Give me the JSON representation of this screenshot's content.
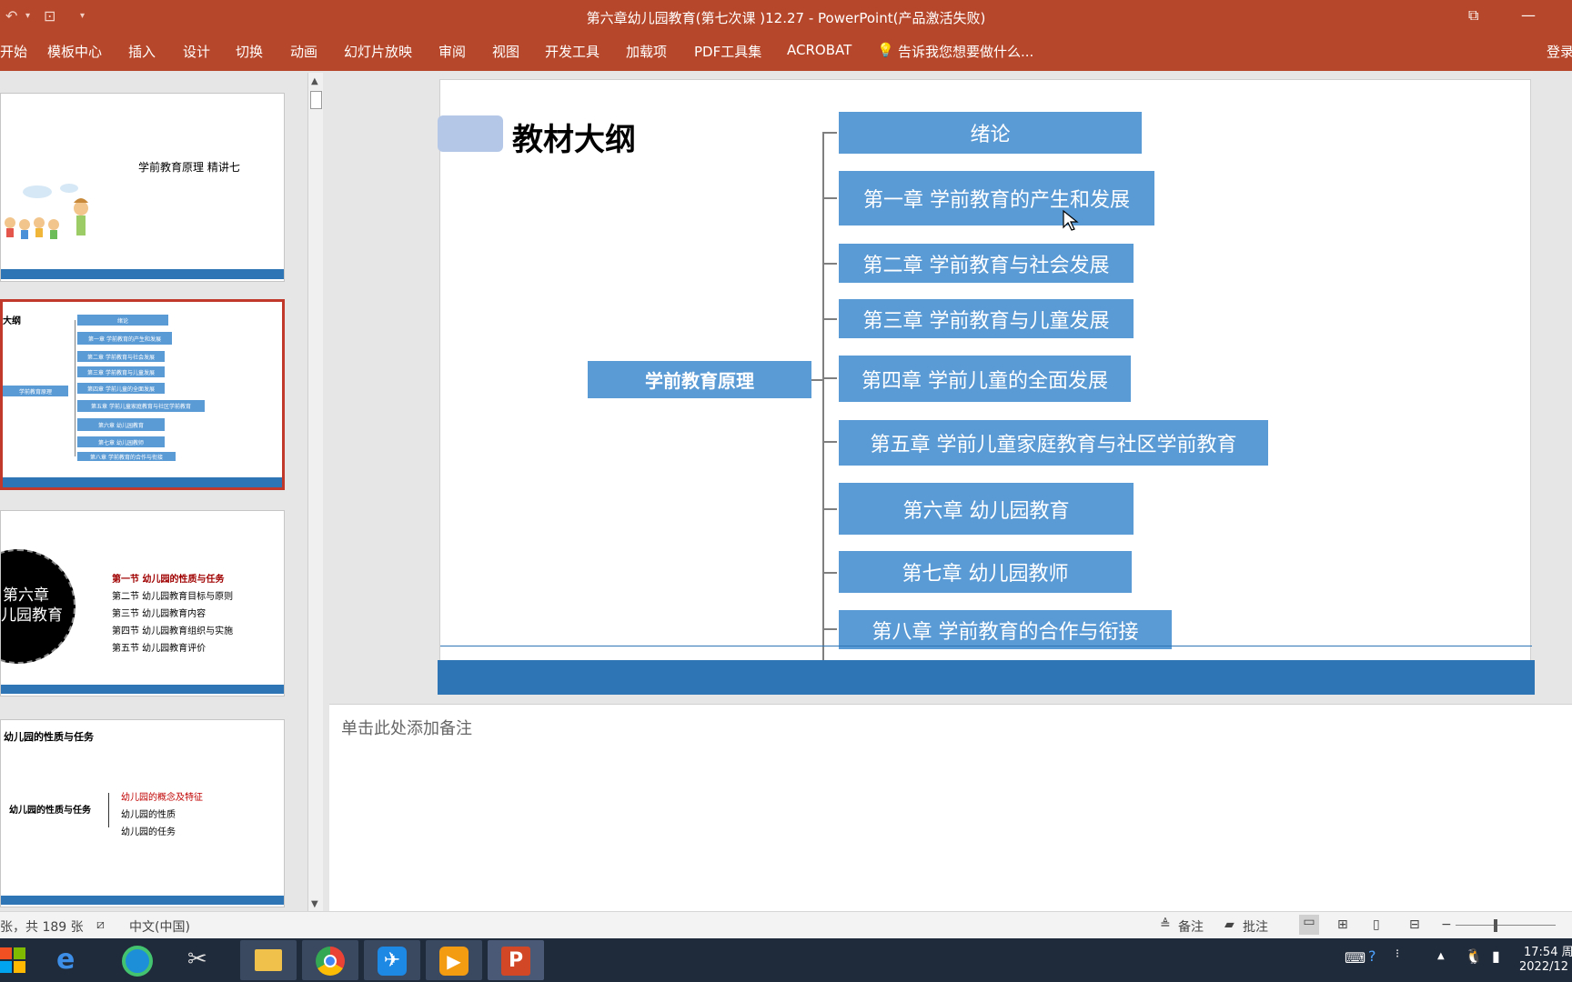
{
  "window": {
    "title": "第六章幼儿园教育(第七次课 )12.27 - PowerPoint(产品激活失败)"
  },
  "ribbon": {
    "tabs": [
      "开始",
      "模板中心",
      "插入",
      "设计",
      "切换",
      "动画",
      "幻灯片放映",
      "审阅",
      "视图",
      "开发工具",
      "加载项",
      "PDF工具集",
      "ACROBAT"
    ],
    "tell_me": "告诉我您想要做什么...",
    "login": "登录"
  },
  "thumbnails": {
    "t1": {
      "text": "学前教育原理  精讲七"
    },
    "t2": {
      "title": "大纲",
      "root": "学前教育原理",
      "items": [
        "绪论",
        "第一章 学前教育的产生和发展",
        "第二章 学前教育与社会发展",
        "第三章 学前教育与儿童发展",
        "第四章 学前儿童的全面发展",
        "第五章 学前儿童家庭教育与社区学前教育",
        "第六章 幼儿园教育",
        "第七章 幼儿园教师",
        "第八章 学前教育的合作与衔接"
      ]
    },
    "t3": {
      "circle_line1": "第六章",
      "circle_line2": "儿园教育",
      "sections": [
        "第一节   幼儿园的性质与任务",
        "第二节   幼儿园教育目标与原则",
        "第三节   幼儿园教育内容",
        "第四节    幼儿园教育组织与实施",
        "第五节    幼儿园教育评价"
      ]
    },
    "t4": {
      "title": "幼儿园的性质与任务",
      "root": "幼儿园的性质与任务",
      "items": [
        "幼儿园的概念及特征",
        "幼儿园的性质",
        "幼儿园的任务"
      ]
    }
  },
  "slide": {
    "title": "教材大纲",
    "root": "学前教育原理",
    "items": [
      "绪论",
      "第一章  学前教育的产生和发展",
      "第二章  学前教育与社会发展",
      "第三章  学前教育与儿童发展",
      "第四章  学前儿童的全面发展",
      "第五章  学前儿童家庭教育与社区学前教育",
      "第六章  幼儿园教育",
      "第七章  幼儿园教师",
      "第八章 学前教育的合作与衔接"
    ]
  },
  "notes": {
    "placeholder": "单击此处添加备注"
  },
  "status": {
    "slide_count": "张，共 189 张",
    "language": "中文(中国)",
    "notes_label": "备注",
    "comments_label": "批注"
  },
  "tray": {
    "time": "17:54 周",
    "date": "2022/12"
  },
  "colors": {
    "accent": "#b7472a",
    "box": "#5b9bd5",
    "bar": "#2e75b6"
  }
}
